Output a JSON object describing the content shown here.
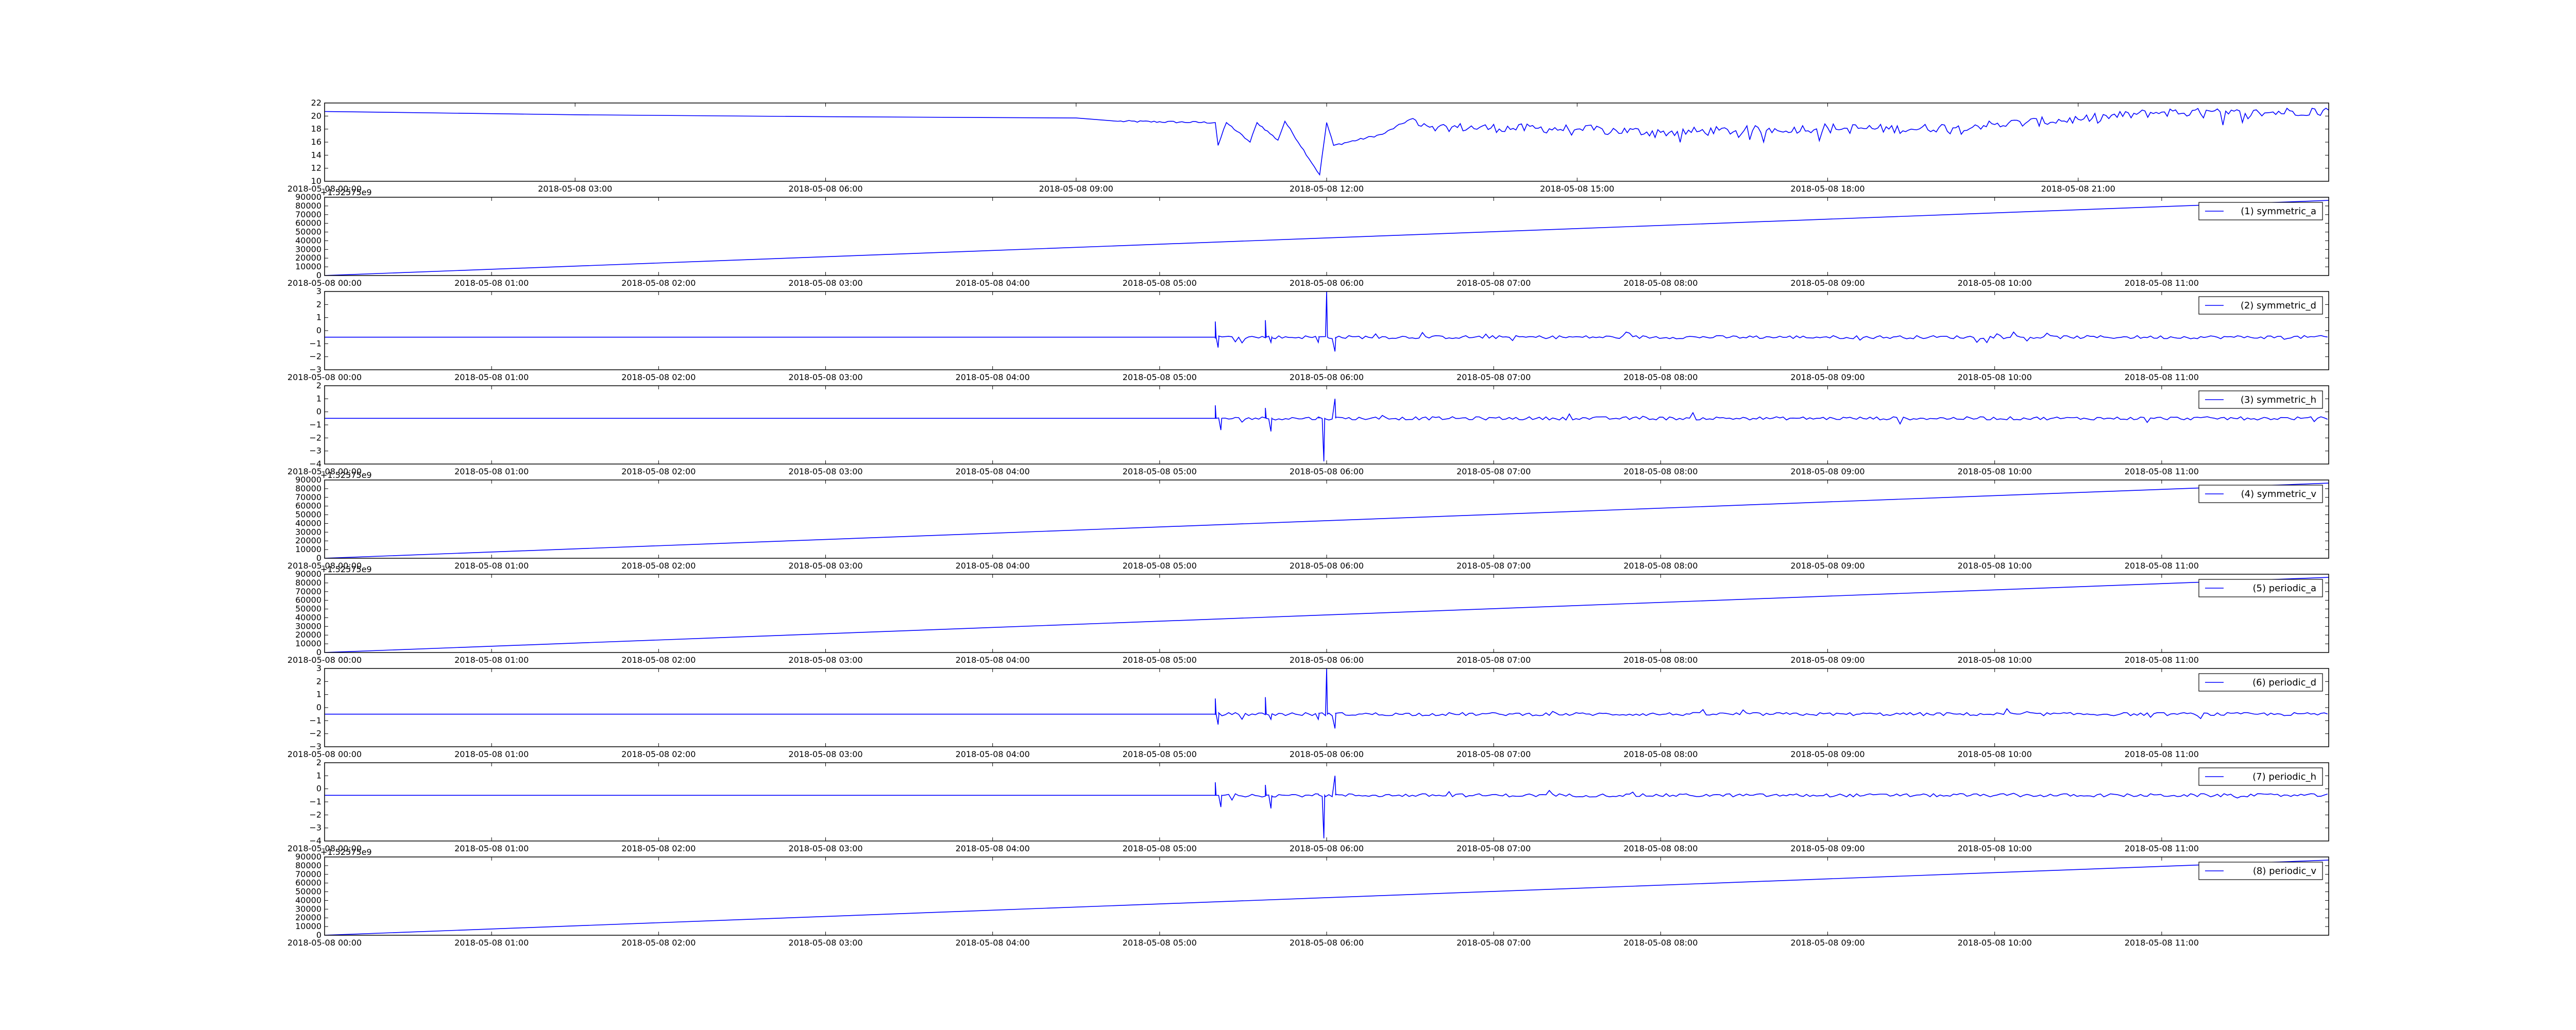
{
  "chart_data": [
    {
      "type": "line",
      "x_range": [
        "2018-05-08 00:00",
        "2018-05-08 24:00"
      ],
      "x_ticks": [
        "2018-05-08 00:00",
        "2018-05-08 03:00",
        "2018-05-08 06:00",
        "2018-05-08 09:00",
        "2018-05-08 12:00",
        "2018-05-08 15:00",
        "2018-05-08 18:00",
        "2018-05-08 21:00"
      ],
      "ylim": [
        10,
        22
      ],
      "y_ticks": [
        "10",
        "12",
        "14",
        "16",
        "18",
        "20",
        "22"
      ],
      "legend": null,
      "series": [
        {
          "color": "#0000ff",
          "points": [
            [
              "2018-05-08 00:00",
              20.7
            ],
            [
              "2018-05-08 03:00",
              20.2
            ],
            [
              "2018-05-08 06:00",
              19.9
            ],
            [
              "2018-05-08 09:00",
              19.7
            ],
            [
              "2018-05-08 09:30",
              19.2
            ],
            [
              "2018-05-08 10:40",
              19.0
            ],
            [
              "2018-05-08 10:42",
              15.5
            ],
            [
              "2018-05-08 10:48",
              19.0
            ],
            [
              "2018-05-08 11:05",
              16.0
            ],
            [
              "2018-05-08 11:10",
              19.0
            ],
            [
              "2018-05-08 11:25",
              16.3
            ],
            [
              "2018-05-08 11:30",
              19.2
            ],
            [
              "2018-05-08 11:55",
              11.0
            ],
            [
              "2018-05-08 12:00",
              19.0
            ],
            [
              "2018-05-08 12:05",
              15.5
            ],
            [
              "2018-05-08 12:40",
              17.2
            ],
            [
              "2018-05-08 13:00",
              19.5
            ],
            [
              "2018-05-08 13:20",
              18.3
            ],
            [
              "2018-05-08 15:00",
              18.0
            ],
            [
              "2018-05-08 16:00",
              17.5
            ],
            [
              "2018-05-08 17:00",
              17.8
            ],
            [
              "2018-05-08 18:00",
              18.2
            ],
            [
              "2018-05-08 19:00",
              18.0
            ],
            [
              "2018-05-08 20:00",
              18.7
            ],
            [
              "2018-05-08 21:00",
              19.5
            ],
            [
              "2018-05-08 22:00",
              20.6
            ],
            [
              "2018-05-08 23:00",
              20.4
            ],
            [
              "2018-05-08 24:00",
              20.9
            ]
          ]
        }
      ]
    },
    {
      "type": "line",
      "x_range": [
        "2018-05-08 00:00",
        "2018-05-08 12:00"
      ],
      "x_ticks": [
        "2018-05-08 00:00",
        "2018-05-08 01:00",
        "2018-05-08 02:00",
        "2018-05-08 03:00",
        "2018-05-08 04:00",
        "2018-05-08 05:00",
        "2018-05-08 06:00",
        "2018-05-08 07:00",
        "2018-05-08 08:00",
        "2018-05-08 09:00",
        "2018-05-08 10:00",
        "2018-05-08 11:00"
      ],
      "ylim": [
        0,
        90000
      ],
      "y_ticks": [
        "0",
        "10000",
        "20000",
        "30000",
        "40000",
        "50000",
        "60000",
        "70000",
        "80000",
        "90000"
      ],
      "y_offset_text": "+1.52575e9",
      "legend": "(1) symmetric_a",
      "series": [
        {
          "name": "(1) symmetric_a",
          "color": "#0000ff",
          "points": [
            [
              "2018-05-08 00:00",
              0
            ],
            [
              "2018-05-08 12:00",
              86400
            ]
          ]
        }
      ]
    },
    {
      "type": "line",
      "x_range": [
        "2018-05-08 00:00",
        "2018-05-08 12:00"
      ],
      "x_ticks": [
        "2018-05-08 00:00",
        "2018-05-08 01:00",
        "2018-05-08 02:00",
        "2018-05-08 03:00",
        "2018-05-08 04:00",
        "2018-05-08 05:00",
        "2018-05-08 06:00",
        "2018-05-08 07:00",
        "2018-05-08 08:00",
        "2018-05-08 09:00",
        "2018-05-08 10:00",
        "2018-05-08 11:00"
      ],
      "ylim": [
        -3,
        3
      ],
      "y_ticks": [
        "−3",
        "−2",
        "−1",
        "0",
        "1",
        "2",
        "3"
      ],
      "legend": "(2) symmetric_d",
      "baseline": -0.5,
      "spikes": [
        [
          "2018-05-08 05:20",
          0.7
        ],
        [
          "2018-05-08 05:21",
          -1.3
        ],
        [
          "2018-05-08 05:38",
          0.8
        ],
        [
          "2018-05-08 05:40",
          -0.9
        ],
        [
          "2018-05-08 05:57",
          -0.9
        ],
        [
          "2018-05-08 06:00",
          3.0
        ],
        [
          "2018-05-08 06:03",
          -1.6
        ]
      ],
      "noise_from": "2018-05-08 05:20",
      "series": [
        {
          "name": "(2) symmetric_d",
          "color": "#0000ff"
        }
      ]
    },
    {
      "type": "line",
      "x_range": [
        "2018-05-08 00:00",
        "2018-05-08 12:00"
      ],
      "x_ticks": [
        "2018-05-08 00:00",
        "2018-05-08 01:00",
        "2018-05-08 02:00",
        "2018-05-08 03:00",
        "2018-05-08 04:00",
        "2018-05-08 05:00",
        "2018-05-08 06:00",
        "2018-05-08 07:00",
        "2018-05-08 08:00",
        "2018-05-08 09:00",
        "2018-05-08 10:00",
        "2018-05-08 11:00"
      ],
      "ylim": [
        -4,
        2
      ],
      "y_ticks": [
        "−4",
        "−3",
        "−2",
        "−1",
        "0",
        "1",
        "2"
      ],
      "legend": "(3) symmetric_h",
      "baseline": -0.5,
      "spikes": [
        [
          "2018-05-08 05:20",
          0.5
        ],
        [
          "2018-05-08 05:22",
          -1.4
        ],
        [
          "2018-05-08 05:38",
          0.3
        ],
        [
          "2018-05-08 05:40",
          -1.5
        ],
        [
          "2018-05-08 05:57",
          -0.4
        ],
        [
          "2018-05-08 05:59",
          -3.8
        ],
        [
          "2018-05-08 06:03",
          1.0
        ]
      ],
      "noise_from": "2018-05-08 05:20",
      "series": [
        {
          "name": "(3) symmetric_h",
          "color": "#0000ff"
        }
      ]
    },
    {
      "type": "line",
      "x_range": [
        "2018-05-08 00:00",
        "2018-05-08 12:00"
      ],
      "x_ticks": [
        "2018-05-08 00:00",
        "2018-05-08 01:00",
        "2018-05-08 02:00",
        "2018-05-08 03:00",
        "2018-05-08 04:00",
        "2018-05-08 05:00",
        "2018-05-08 06:00",
        "2018-05-08 07:00",
        "2018-05-08 08:00",
        "2018-05-08 09:00",
        "2018-05-08 10:00",
        "2018-05-08 11:00"
      ],
      "ylim": [
        0,
        90000
      ],
      "y_ticks": [
        "0",
        "10000",
        "20000",
        "30000",
        "40000",
        "50000",
        "60000",
        "70000",
        "80000",
        "90000"
      ],
      "y_offset_text": "+1.52575e9",
      "legend": "(4) symmetric_v",
      "series": [
        {
          "name": "(4) symmetric_v",
          "color": "#0000ff",
          "points": [
            [
              "2018-05-08 00:00",
              0
            ],
            [
              "2018-05-08 12:00",
              86400
            ]
          ]
        }
      ]
    },
    {
      "type": "line",
      "x_range": [
        "2018-05-08 00:00",
        "2018-05-08 12:00"
      ],
      "x_ticks": [
        "2018-05-08 00:00",
        "2018-05-08 01:00",
        "2018-05-08 02:00",
        "2018-05-08 03:00",
        "2018-05-08 04:00",
        "2018-05-08 05:00",
        "2018-05-08 06:00",
        "2018-05-08 07:00",
        "2018-05-08 08:00",
        "2018-05-08 09:00",
        "2018-05-08 10:00",
        "2018-05-08 11:00"
      ],
      "ylim": [
        0,
        90000
      ],
      "y_ticks": [
        "0",
        "10000",
        "20000",
        "30000",
        "40000",
        "50000",
        "60000",
        "70000",
        "80000",
        "90000"
      ],
      "y_offset_text": "+1.52575e9",
      "legend": "(5) periodic_a",
      "series": [
        {
          "name": "(5) periodic_a",
          "color": "#0000ff",
          "points": [
            [
              "2018-05-08 00:00",
              0
            ],
            [
              "2018-05-08 12:00",
              86400
            ]
          ]
        }
      ]
    },
    {
      "type": "line",
      "x_range": [
        "2018-05-08 00:00",
        "2018-05-08 12:00"
      ],
      "x_ticks": [
        "2018-05-08 00:00",
        "2018-05-08 01:00",
        "2018-05-08 02:00",
        "2018-05-08 03:00",
        "2018-05-08 04:00",
        "2018-05-08 05:00",
        "2018-05-08 06:00",
        "2018-05-08 07:00",
        "2018-05-08 08:00",
        "2018-05-08 09:00",
        "2018-05-08 10:00",
        "2018-05-08 11:00"
      ],
      "ylim": [
        -3,
        3
      ],
      "y_ticks": [
        "−3",
        "−2",
        "−1",
        "0",
        "1",
        "2",
        "3"
      ],
      "legend": "(6) periodic_d",
      "baseline": -0.5,
      "spikes": [
        [
          "2018-05-08 05:20",
          0.7
        ],
        [
          "2018-05-08 05:21",
          -1.3
        ],
        [
          "2018-05-08 05:38",
          0.8
        ],
        [
          "2018-05-08 05:40",
          -0.9
        ],
        [
          "2018-05-08 05:57",
          -0.9
        ],
        [
          "2018-05-08 06:00",
          3.0
        ],
        [
          "2018-05-08 06:03",
          -1.6
        ]
      ],
      "noise_from": "2018-05-08 05:20",
      "series": [
        {
          "name": "(6) periodic_d",
          "color": "#0000ff"
        }
      ]
    },
    {
      "type": "line",
      "x_range": [
        "2018-05-08 00:00",
        "2018-05-08 12:00"
      ],
      "x_ticks": [
        "2018-05-08 00:00",
        "2018-05-08 01:00",
        "2018-05-08 02:00",
        "2018-05-08 03:00",
        "2018-05-08 04:00",
        "2018-05-08 05:00",
        "2018-05-08 06:00",
        "2018-05-08 07:00",
        "2018-05-08 08:00",
        "2018-05-08 09:00",
        "2018-05-08 10:00",
        "2018-05-08 11:00"
      ],
      "ylim": [
        -4,
        2
      ],
      "y_ticks": [
        "−4",
        "−3",
        "−2",
        "−1",
        "0",
        "1",
        "2"
      ],
      "legend": "(7) periodic_h",
      "baseline": -0.5,
      "spikes": [
        [
          "2018-05-08 05:20",
          0.5
        ],
        [
          "2018-05-08 05:22",
          -1.4
        ],
        [
          "2018-05-08 05:38",
          0.3
        ],
        [
          "2018-05-08 05:40",
          -1.5
        ],
        [
          "2018-05-08 05:57",
          -0.4
        ],
        [
          "2018-05-08 05:59",
          -3.8
        ],
        [
          "2018-05-08 06:03",
          1.0
        ]
      ],
      "noise_from": "2018-05-08 05:20",
      "series": [
        {
          "name": "(7) periodic_h",
          "color": "#0000ff"
        }
      ]
    },
    {
      "type": "line",
      "x_range": [
        "2018-05-08 00:00",
        "2018-05-08 12:00"
      ],
      "x_ticks": [
        "2018-05-08 00:00",
        "2018-05-08 01:00",
        "2018-05-08 02:00",
        "2018-05-08 03:00",
        "2018-05-08 04:00",
        "2018-05-08 05:00",
        "2018-05-08 06:00",
        "2018-05-08 07:00",
        "2018-05-08 08:00",
        "2018-05-08 09:00",
        "2018-05-08 10:00",
        "2018-05-08 11:00"
      ],
      "ylim": [
        0,
        90000
      ],
      "y_ticks": [
        "0",
        "10000",
        "20000",
        "30000",
        "40000",
        "50000",
        "60000",
        "70000",
        "80000",
        "90000"
      ],
      "y_offset_text": "+1.52575e9",
      "legend": "(8) periodic_v",
      "series": [
        {
          "name": "(8) periodic_v",
          "color": "#0000ff",
          "points": [
            [
              "2018-05-08 00:00",
              0
            ],
            [
              "2018-05-08 12:00",
              86400
            ]
          ]
        }
      ]
    }
  ]
}
